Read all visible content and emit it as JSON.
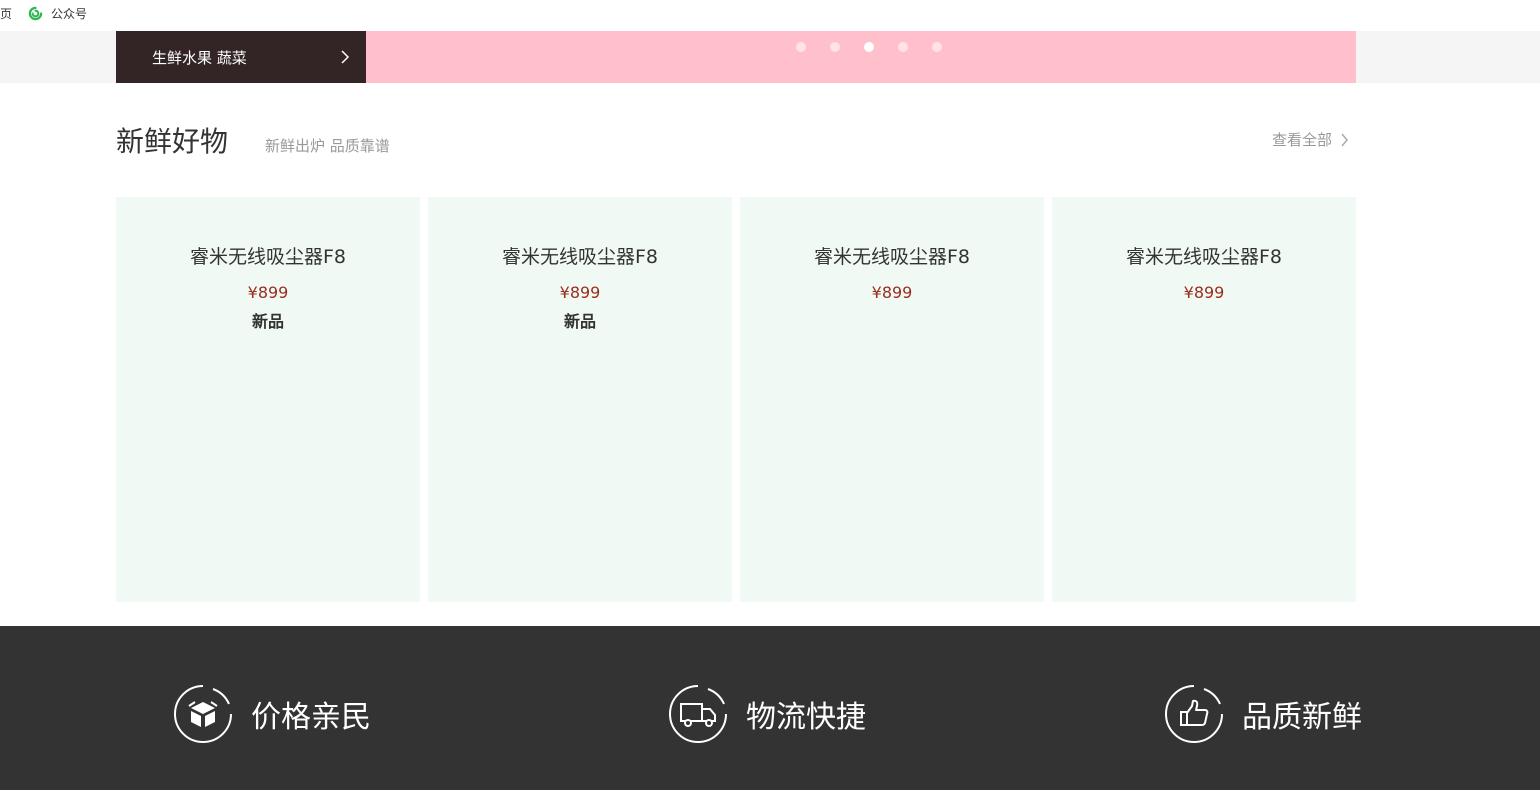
{
  "bookmarks": {
    "cut_label": "页",
    "item_label": "公众号"
  },
  "hero": {
    "category_label": "生鲜水果 蔬菜",
    "banner_color": "#ffc0cb",
    "category_bg": "#332525",
    "carousel_dots": 5,
    "active_dot_index": 2
  },
  "section": {
    "title": "新鲜好物",
    "subtitle": "新鲜出炉 品质靠谱",
    "view_all_label": "查看全部"
  },
  "products": [
    {
      "name": "睿米无线吸尘器F8",
      "price": "¥899",
      "tag": "新品"
    },
    {
      "name": "睿米无线吸尘器F8",
      "price": "¥899",
      "tag": "新品"
    },
    {
      "name": "睿米无线吸尘器F8",
      "price": "¥899",
      "tag": ""
    },
    {
      "name": "睿米无线吸尘器F8",
      "price": "¥899",
      "tag": ""
    }
  ],
  "services": [
    {
      "icon": "box-icon",
      "label": "价格亲民"
    },
    {
      "icon": "truck-icon",
      "label": "物流快捷"
    },
    {
      "icon": "thumbs-up-icon",
      "label": "品质新鲜"
    }
  ],
  "colors": {
    "price": "#9a2e1f",
    "card_bg": "#f0f9f4",
    "footer_bg": "#333333"
  }
}
